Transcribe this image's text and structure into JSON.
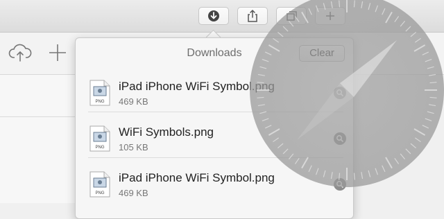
{
  "toolbar": {
    "buttons": [
      {
        "name": "downloads-button",
        "icon": "download-arrow-icon"
      },
      {
        "name": "share-button",
        "icon": "share-icon"
      },
      {
        "name": "tab-overview-button",
        "icon": "tabs-icon"
      },
      {
        "name": "new-tab-button",
        "icon": "plus-icon"
      }
    ]
  },
  "secondary_bar": {
    "icons": [
      "cloud-upload-icon",
      "plus-icon"
    ]
  },
  "downloads": {
    "title": "Downloads",
    "clear_label": "Clear",
    "items": [
      {
        "name": "iPad iPhone WiFi Symbol.png",
        "size": "469 KB",
        "icon_label": "PNG"
      },
      {
        "name": "WiFi Symbols.png",
        "size": "105 KB",
        "icon_label": "PNG"
      },
      {
        "name": "iPad iPhone WiFi Symbol.png",
        "size": "469 KB",
        "icon_label": "PNG"
      }
    ]
  },
  "overlay": {
    "icon": "safari-compass-icon"
  },
  "colors": {
    "toolbar_bg": "#e3e3e3",
    "popover_bg": "#f6f6f6",
    "text": "#222222",
    "compass": "#a0a0a0"
  }
}
